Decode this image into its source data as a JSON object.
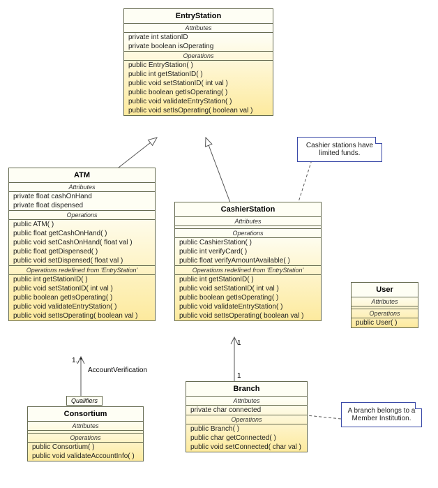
{
  "chart_data": {
    "type": "diagram",
    "diagram_kind": "UML class diagram",
    "classes": [
      {
        "name": "EntryStation"
      },
      {
        "name": "ATM",
        "inherits": "EntryStation"
      },
      {
        "name": "CashierStation",
        "inherits": "EntryStation"
      },
      {
        "name": "Consortium",
        "assoc": [
          {
            "to": "ATM",
            "name": "AccountVerification",
            "mult": "1..*",
            "qualifier": "Qualifiers"
          }
        ]
      },
      {
        "name": "Branch",
        "assoc": [
          {
            "to": "CashierStation",
            "mult_near": "1",
            "mult_far": "1"
          }
        ]
      },
      {
        "name": "User"
      }
    ],
    "notes": [
      {
        "text": "Cashier stations have limited funds.",
        "attached_to": "CashierStation"
      },
      {
        "text": "A branch belongs to a Member Institution.",
        "attached_to": "Branch"
      }
    ]
  },
  "entry": {
    "title": "EntryStation",
    "attr_hdr": "Attributes",
    "op_hdr": "Operations",
    "attrs": [
      "private int stationID",
      "private boolean isOperating"
    ],
    "ops": [
      "public EntryStation(  )",
      "public int  getStationID(  )",
      "public void  setStationID( int val )",
      "public boolean  getIsOperating(  )",
      "public void  validateEntryStation(  )",
      "public void  setIsOperating( boolean val )"
    ]
  },
  "atm": {
    "title": "ATM",
    "attr_hdr": "Attributes",
    "op_hdr": "Operations",
    "redef_hdr": "Operations redefined from 'EntryStation'",
    "attrs": [
      "private float cashOnHand",
      "private float dispensed"
    ],
    "ops": [
      "public ATM(  )",
      "public float  getCashOnHand(  )",
      "public void  setCashOnHand( float val )",
      "public float  getDispensed(  )",
      "public void  setDispensed( float val )"
    ],
    "redef": [
      "public int  getStationID(  )",
      "public void  setStationID( int val )",
      "public boolean  getIsOperating(  )",
      "public void  validateEntryStation(  )",
      "public void  setIsOperating( boolean val )"
    ]
  },
  "cashier": {
    "title": "CashierStation",
    "attr_hdr": "Attributes",
    "op_hdr": "Operations",
    "redef_hdr": "Operations redefined from 'EntryStation'",
    "ops": [
      "public CashierStation(  )",
      "public int  verifyCard(  )",
      "public float  verifyAmountAvailable(  )"
    ],
    "redef": [
      "public int  getStationID(  )",
      "public void  setStationID( int val )",
      "public boolean  getIsOperating(  )",
      "public void  validateEntryStation(  )",
      "public void  setIsOperating( boolean val )"
    ]
  },
  "user": {
    "title": "User",
    "attr_hdr": "Attributes",
    "op_hdr": "Operations",
    "ops": [
      "public User(  )"
    ]
  },
  "branch": {
    "title": "Branch",
    "attr_hdr": "Attributes",
    "op_hdr": "Operations",
    "attrs": [
      "private char connected"
    ],
    "ops": [
      "public Branch(  )",
      "public char  getConnected(  )",
      "public void  setConnected( char val )"
    ]
  },
  "consortium": {
    "title": "Consortium",
    "attr_hdr": "Attributes",
    "op_hdr": "Operations",
    "ops": [
      "public Consortium(  )",
      "public void  validateAccountInfo(  )"
    ]
  },
  "qualifier_label": "Qualifiers",
  "assoc_label": "AccountVerification",
  "mult_1s": "1",
  "mult_1x": "1..*",
  "note1": "Cashier stations have limited funds.",
  "note2": "A branch belongs to a Member Institution."
}
